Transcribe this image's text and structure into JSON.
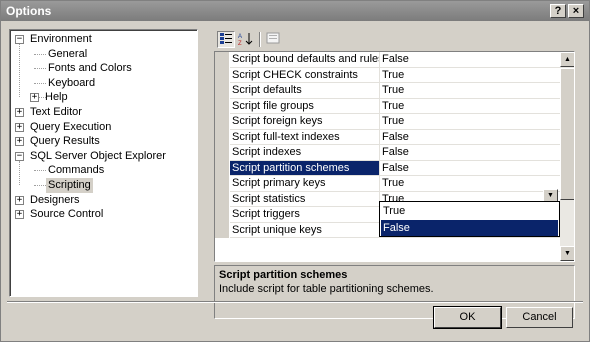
{
  "window": {
    "title": "Options",
    "help_glyph": "?",
    "close_glyph": "×"
  },
  "tree": {
    "nodes": [
      {
        "label": "Environment",
        "expander": "−"
      },
      {
        "label": "General"
      },
      {
        "label": "Fonts and Colors"
      },
      {
        "label": "Keyboard"
      },
      {
        "label": "Help",
        "expander": "+"
      },
      {
        "label": "Text Editor",
        "expander": "+"
      },
      {
        "label": "Query Execution",
        "expander": "+"
      },
      {
        "label": "Query Results",
        "expander": "+"
      },
      {
        "label": "SQL Server Object Explorer",
        "expander": "−"
      },
      {
        "label": "Commands"
      },
      {
        "label": "Scripting",
        "selected": true
      },
      {
        "label": "Designers",
        "expander": "+"
      },
      {
        "label": "Source Control",
        "expander": "+"
      }
    ]
  },
  "toolbar": {
    "categorized_icon": "categorized-icon",
    "alphabetical_icon": "sort-alphabetical-icon",
    "property_pages_icon": "property-pages-icon"
  },
  "grid": {
    "rows": [
      {
        "name": "Script bound defaults and rules",
        "value": "False"
      },
      {
        "name": "Script CHECK constraints",
        "value": "True"
      },
      {
        "name": "Script defaults",
        "value": "True"
      },
      {
        "name": "Script file groups",
        "value": "True"
      },
      {
        "name": "Script foreign keys",
        "value": "True"
      },
      {
        "name": "Script full-text indexes",
        "value": "False"
      },
      {
        "name": "Script indexes",
        "value": "False"
      },
      {
        "name": "Script partition schemes",
        "value": "False",
        "selected": true
      },
      {
        "name": "Script primary keys",
        "value": "True"
      },
      {
        "name": "Script statistics",
        "value": "True"
      },
      {
        "name": "Script triggers",
        "value": "False"
      },
      {
        "name": "Script unique keys",
        "value": "True"
      }
    ],
    "dropdown_options": [
      "True",
      "False"
    ],
    "dropdown_highlighted": "False"
  },
  "description": {
    "title": "Script partition schemes",
    "text": "Include script for table partitioning schemes."
  },
  "buttons": {
    "ok": "OK",
    "cancel": "Cancel"
  },
  "colors": {
    "selection": "#0a246a",
    "dialog_face": "#d4d0c8"
  }
}
